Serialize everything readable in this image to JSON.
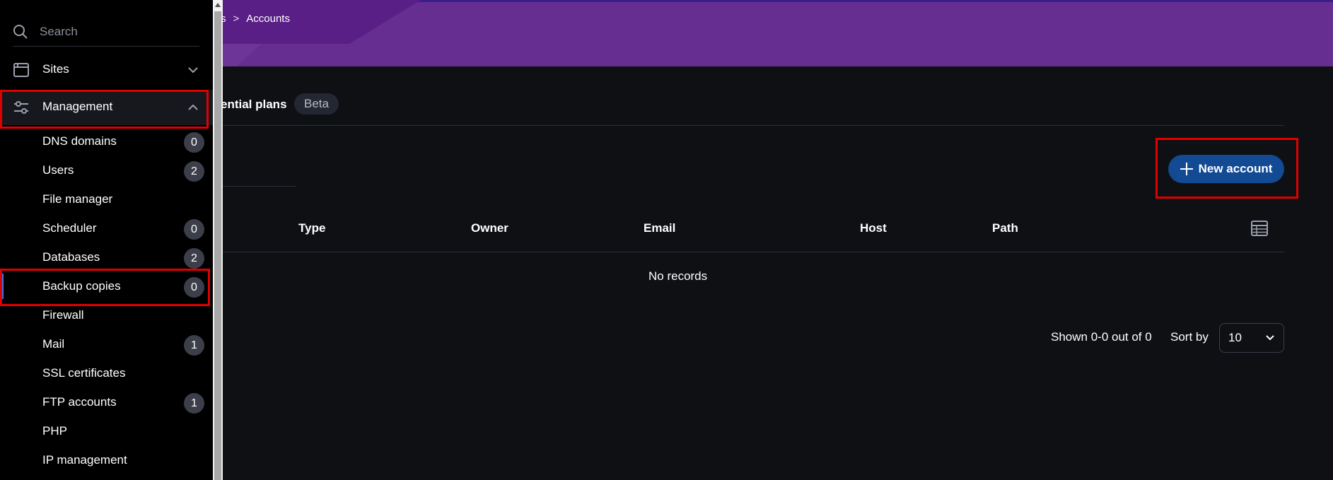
{
  "breadcrumb": {
    "partial": "s",
    "separator": ">",
    "current": "Accounts"
  },
  "tabs": {
    "active_label_partial": "ential plans",
    "beta_badge": "Beta"
  },
  "actions": {
    "new_account_label": "New account"
  },
  "table": {
    "columns": [
      "Type",
      "Owner",
      "Email",
      "Host",
      "Path"
    ],
    "empty_text": "No records"
  },
  "pagination": {
    "shown_text": "Shown 0-0 out of 0",
    "sort_by_label": "Sort by",
    "per_page_value": "10"
  },
  "sidebar": {
    "search_placeholder": "Search",
    "sites_label": "Sites",
    "management_label": "Management",
    "items": [
      {
        "label": "DNS domains",
        "count": "0"
      },
      {
        "label": "Users",
        "count": "2"
      },
      {
        "label": "File manager",
        "count": null
      },
      {
        "label": "Scheduler",
        "count": "0"
      },
      {
        "label": "Databases",
        "count": "2"
      },
      {
        "label": "Backup copies",
        "count": "0"
      },
      {
        "label": "Firewall",
        "count": null
      },
      {
        "label": "Mail",
        "count": "1"
      },
      {
        "label": "SSL certificates",
        "count": null
      },
      {
        "label": "FTP accounts",
        "count": "1"
      },
      {
        "label": "PHP",
        "count": null
      },
      {
        "label": "IP management",
        "count": null
      }
    ]
  },
  "colors": {
    "banner": "#662e91",
    "background": "#0e1014",
    "primary_button": "#124a93",
    "highlight": "#e00000",
    "active_indicator": "#2f7be8"
  },
  "icons": {
    "search": "search-icon",
    "sites": "browser-window-icon",
    "management": "sliders-icon",
    "columns": "table-columns-icon",
    "plus": "plus-icon",
    "chevron_down": "chevron-down-icon",
    "chevron_up": "chevron-up-icon"
  }
}
